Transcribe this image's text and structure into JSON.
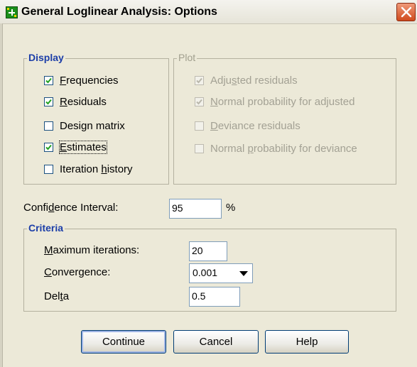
{
  "window": {
    "title": "General Loglinear Analysis: Options",
    "icon": "spss-dialog-icon",
    "close_icon": "close-icon"
  },
  "display": {
    "legend": "Display",
    "items": [
      {
        "pre": "",
        "acc": "F",
        "post": "requencies",
        "checked": true
      },
      {
        "pre": "",
        "acc": "R",
        "post": "esiduals",
        "checked": true
      },
      {
        "pre": "Design matrix",
        "acc": "",
        "post": "",
        "checked": false
      },
      {
        "pre": "",
        "acc": "E",
        "post": "stimates",
        "checked": true
      },
      {
        "pre": "Iteration ",
        "acc": "h",
        "post": "istory",
        "checked": false
      }
    ]
  },
  "plot": {
    "legend": "Plot",
    "items": [
      {
        "pre": "Adju",
        "acc": "s",
        "post": "ted residuals",
        "checked": true
      },
      {
        "pre": "",
        "acc": "N",
        "post": "ormal probability for adjusted",
        "checked": true
      },
      {
        "pre": "",
        "acc": "D",
        "post": "eviance residuals",
        "checked": false
      },
      {
        "pre": "Normal ",
        "acc": "p",
        "post": "robability for deviance",
        "checked": false
      }
    ]
  },
  "confidence": {
    "label_pre": "Confi",
    "label_acc": "d",
    "label_post": "ence Interval:",
    "value": "95",
    "unit": "%"
  },
  "criteria": {
    "legend": "Criteria",
    "max_iter_label_acc": "M",
    "max_iter_label_post": "aximum iterations:",
    "max_iter_value": "20",
    "convergence_label_acc": "C",
    "convergence_label_post": "onvergence:",
    "convergence_value": "0.001",
    "delta_label_pre": "Del",
    "delta_label_acc": "t",
    "delta_label_post": "a",
    "delta_value": "0.5"
  },
  "buttons": {
    "continue": "Continue",
    "cancel": "Cancel",
    "help": "Help"
  }
}
